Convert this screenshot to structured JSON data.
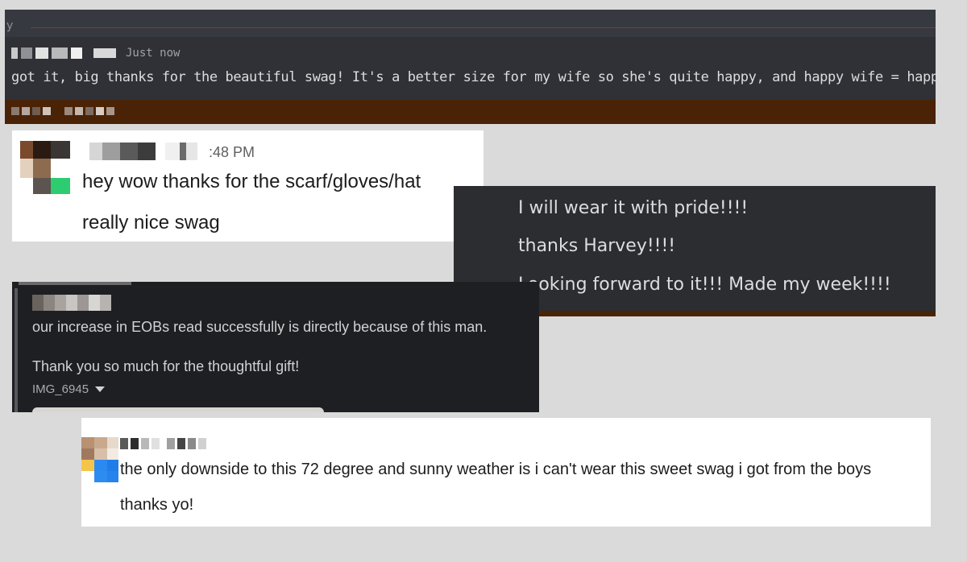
{
  "card1": {
    "top_letter": "y",
    "timestamp": "Just now",
    "message": "got it, big thanks for the beautiful swag! It's a better size for my wife so she's quite happy, and happy wife = happy life",
    "emoji": "slightly-smiling-face"
  },
  "card2": {
    "timestamp": ":48 PM",
    "line1": "hey wow thanks for the scarf/gloves/hat",
    "line2": "really nice swag"
  },
  "card3": {
    "line1": "I will wear it with pride!!!!",
    "line2": "thanks Harvey!!!!",
    "line3": "Looking forward to it!!! Made my week!!!!"
  },
  "card4": {
    "line1": "our increase in EOBs read successfully is directly because of this man.",
    "line2": "Thank you so much for the thoughtful gift!",
    "file_name": "IMG_6945"
  },
  "card5": {
    "line1": "the only downside to this 72 degree and sunny weather is i can't wear this sweet swag i got from the boys",
    "line2": "thanks yo!"
  },
  "colors": {
    "page_bg": "#dadada",
    "discord_bg": "#2f3136",
    "dark_brown": "#4a2306",
    "slack_white": "#ffffff",
    "slack_dark": "#1e1f22"
  }
}
